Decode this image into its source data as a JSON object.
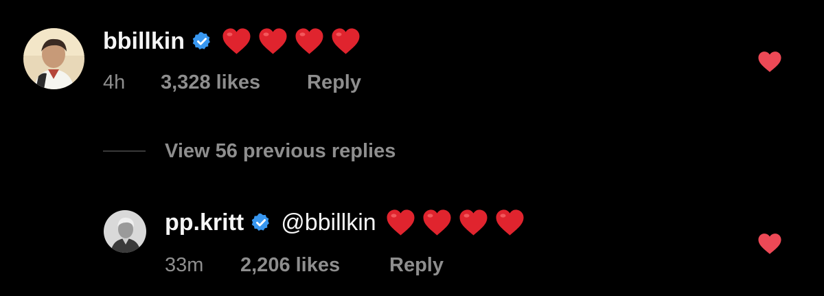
{
  "colors": {
    "background": "#000000",
    "text_primary": "#f5f5f5",
    "text_secondary": "#8e8e8e",
    "verified_blue": "#3897f0",
    "heart_red": "#ed4956"
  },
  "comments": [
    {
      "username": "bbillkin",
      "verified": true,
      "mention": "",
      "emoji": [
        "red-heart",
        "red-heart",
        "red-heart",
        "red-heart"
      ],
      "time": "4h",
      "likes": "3,328 likes",
      "reply_label": "Reply",
      "liked": true
    },
    {
      "username": "pp.kritt",
      "verified": true,
      "mention": "@bbillkin",
      "emoji": [
        "red-heart",
        "red-heart",
        "red-heart",
        "red-heart"
      ],
      "time": "33m",
      "likes": "2,206 likes",
      "reply_label": "Reply",
      "liked": true
    }
  ],
  "view_replies": {
    "label": "View 56 previous replies"
  }
}
